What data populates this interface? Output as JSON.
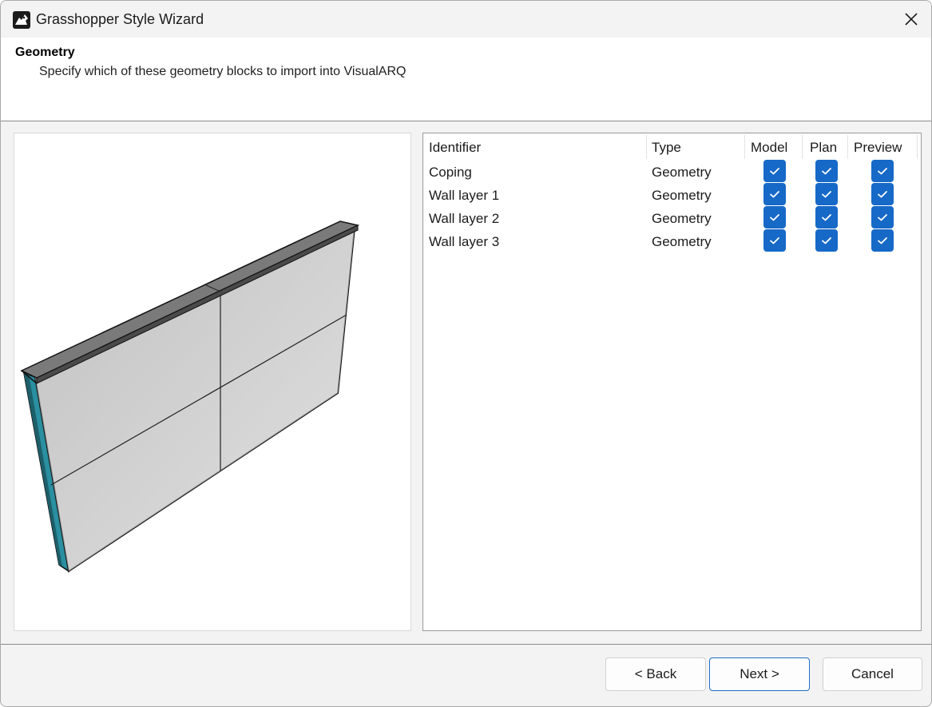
{
  "window": {
    "title": "Grasshopper Style Wizard"
  },
  "header": {
    "title": "Geometry",
    "subtitle": "Specify which of these geometry blocks to import into VisualARQ"
  },
  "table": {
    "columns": [
      "Identifier",
      "Type",
      "Model",
      "Plan",
      "Preview"
    ],
    "rows": [
      {
        "identifier": "Coping",
        "type": "Geometry",
        "model": true,
        "plan": true,
        "preview": true
      },
      {
        "identifier": "Wall layer 1",
        "type": "Geometry",
        "model": true,
        "plan": true,
        "preview": true
      },
      {
        "identifier": "Wall layer 2",
        "type": "Geometry",
        "model": true,
        "plan": true,
        "preview": true
      },
      {
        "identifier": "Wall layer 3",
        "type": "Geometry",
        "model": true,
        "plan": true,
        "preview": true
      }
    ]
  },
  "buttons": {
    "back": "< Back",
    "next": "Next >",
    "cancel": "Cancel"
  },
  "colors": {
    "accent": "#1769c7",
    "wall_face": "#cfcfcf",
    "wall_edge": "#2a8fa0",
    "coping": "#6e6e6e"
  }
}
